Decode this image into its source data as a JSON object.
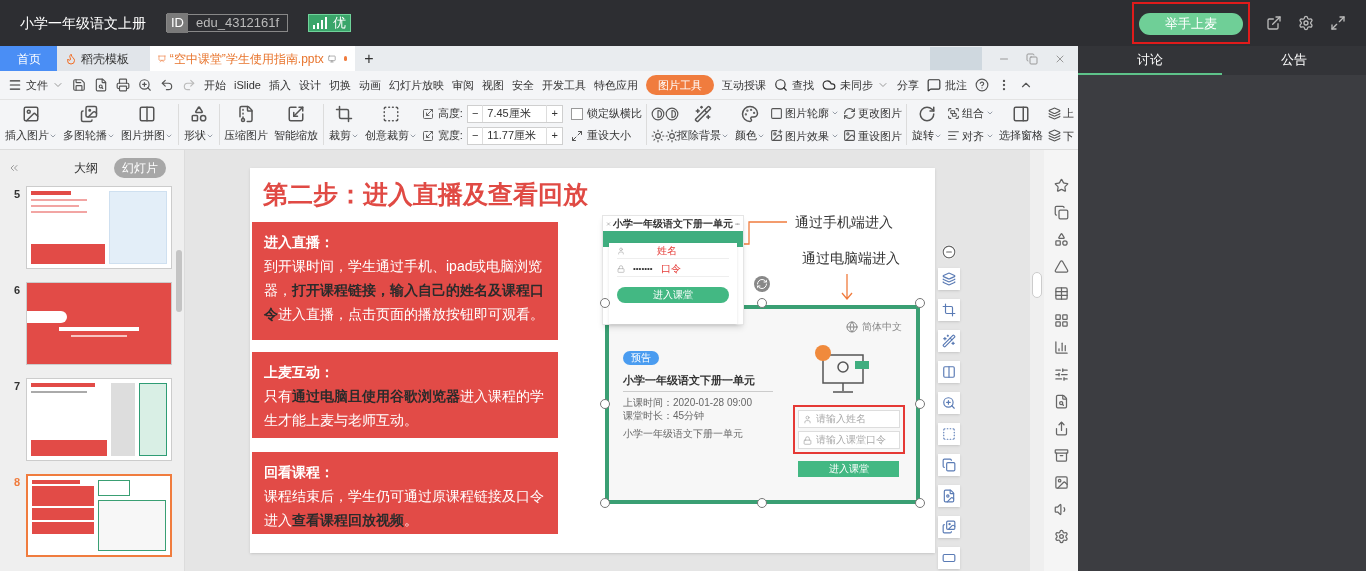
{
  "header": {
    "title": "小学一年级语文上册",
    "id_label": "ID",
    "id_value": "edu_4312161f",
    "quality": "优",
    "raise_hand": "举手上麦"
  },
  "side_panel": {
    "tabs": [
      {
        "label": "讨论",
        "selected": true
      },
      {
        "label": "公告",
        "selected": false
      }
    ]
  },
  "doc_tabs": [
    {
      "label": "首页",
      "kind": "home",
      "selected": false
    },
    {
      "label": "稻壳模板",
      "kind": "template",
      "selected": false
    },
    {
      "label": "“空中课堂”学生使用指南.pptx",
      "kind": "file",
      "selected": true
    }
  ],
  "new_tab": "+",
  "menu": {
    "file": "文件",
    "items": [
      {
        "label": "开始",
        "selected": false
      },
      {
        "label": "iSlide",
        "selected": false
      },
      {
        "label": "插入",
        "selected": false
      },
      {
        "label": "设计",
        "selected": false
      },
      {
        "label": "切换",
        "selected": false
      },
      {
        "label": "动画",
        "selected": false
      },
      {
        "label": "幻灯片放映",
        "selected": false
      },
      {
        "label": "审阅",
        "selected": false
      },
      {
        "label": "视图",
        "selected": false
      },
      {
        "label": "安全",
        "selected": false
      },
      {
        "label": "开发工具",
        "selected": false
      },
      {
        "label": "特色应用",
        "selected": false
      },
      {
        "label": "图片工具",
        "selected": true
      },
      {
        "label": "互动授课",
        "selected": false
      }
    ],
    "search": "查找",
    "sync": "未同步",
    "share": "分享",
    "comment": "批注"
  },
  "ribbon": [
    {
      "kind": "large",
      "label": "插入图片",
      "dropdown": true
    },
    {
      "kind": "large",
      "label": "多图轮播",
      "dropdown": true
    },
    {
      "kind": "large",
      "label": "图片拼图",
      "dropdown": true
    },
    {
      "kind": "sep"
    },
    {
      "kind": "large",
      "label": "形状",
      "dropdown": true
    },
    {
      "kind": "sep"
    },
    {
      "kind": "large",
      "label": "压缩图片",
      "dropdown": false
    },
    {
      "kind": "large",
      "label": "智能缩放",
      "dropdown": false
    },
    {
      "kind": "sep"
    },
    {
      "kind": "large",
      "label": "裁剪",
      "dropdown": true
    },
    {
      "kind": "large",
      "label": "创意裁剪",
      "dropdown": true
    },
    {
      "kind": "size",
      "height_label": "高度:",
      "height_value": "7.45厘米",
      "width_label": "宽度:",
      "width_value": "11.77厘米",
      "minus": "−",
      "plus": "+",
      "lock_label": "锁定纵横比",
      "lock_checked": false,
      "reset": "重设大小"
    },
    {
      "kind": "sep"
    },
    {
      "kind": "adjust"
    },
    {
      "kind": "large",
      "label": "抠除背景",
      "dropdown": true
    },
    {
      "kind": "large",
      "label": "颜色",
      "dropdown": true
    },
    {
      "kind": "stack",
      "items": [
        {
          "label": "图片轮廓",
          "dropdown": true
        },
        {
          "label": "图片效果",
          "dropdown": true
        }
      ]
    },
    {
      "kind": "stack",
      "items": [
        {
          "label": "更改图片",
          "dropdown": false
        },
        {
          "label": "重设图片",
          "dropdown": false
        }
      ]
    },
    {
      "kind": "sep"
    },
    {
      "kind": "large",
      "label": "旋转",
      "dropdown": true
    },
    {
      "kind": "stack",
      "items": [
        {
          "label": "组合",
          "dropdown": true
        },
        {
          "label": "对齐",
          "dropdown": true
        }
      ]
    },
    {
      "kind": "large",
      "label": "选择窗格",
      "dropdown": false
    },
    {
      "kind": "stack",
      "items": [
        {
          "label": "上",
          "dropdown": false
        },
        {
          "label": "下",
          "dropdown": false
        }
      ]
    }
  ],
  "panel_tabs": [
    {
      "label": "大纲",
      "selected": false
    },
    {
      "label": "幻灯片",
      "selected": true
    }
  ],
  "thumbnails": [
    {
      "number": "5",
      "kind": "web",
      "selected": false
    },
    {
      "number": "6",
      "kind": "section",
      "selected": false
    },
    {
      "number": "7",
      "kind": "phone",
      "selected": false
    },
    {
      "number": "8",
      "kind": "steps",
      "selected": true
    }
  ],
  "slide": {
    "title": "第二步：进入直播及查看回放",
    "blocks": [
      {
        "heading": "进入直播：",
        "text": "到开课时间，学生通过手机、ipad或电脑浏览器，**打开课程链接，输入自己的姓名及课程口令**进入直播，点击页面的播放按钮即可观看。"
      },
      {
        "heading": "上麦互动：",
        "text": "只有**通过电脑且使用谷歌浏览器**进入课程的学生才能上麦与老师互动。"
      },
      {
        "heading": "回看课程：",
        "text": "课程结束后，学生仍可通过原课程链接及口令进入**查看课程回放视频**。"
      }
    ],
    "mobile_label": "通过手机端进入",
    "pc_label": "通过电脑端进入",
    "phone": {
      "title": "小学一年级语文下册一单元",
      "name_label": "姓名",
      "password": "•••••••",
      "code_label": "口令",
      "button": "进入课堂"
    },
    "pc": {
      "language": "简体中文",
      "badge": "预告",
      "title": "小学一年级语文下册一单元",
      "start_time": "上课时间：2020-01-28 09:00",
      "duration": "课堂时长：45分钟",
      "description": "小学一年级语文下册一单元",
      "name_placeholder": "请输入姓名",
      "code_placeholder": "请输入课堂口令",
      "button": "进入课堂"
    }
  }
}
